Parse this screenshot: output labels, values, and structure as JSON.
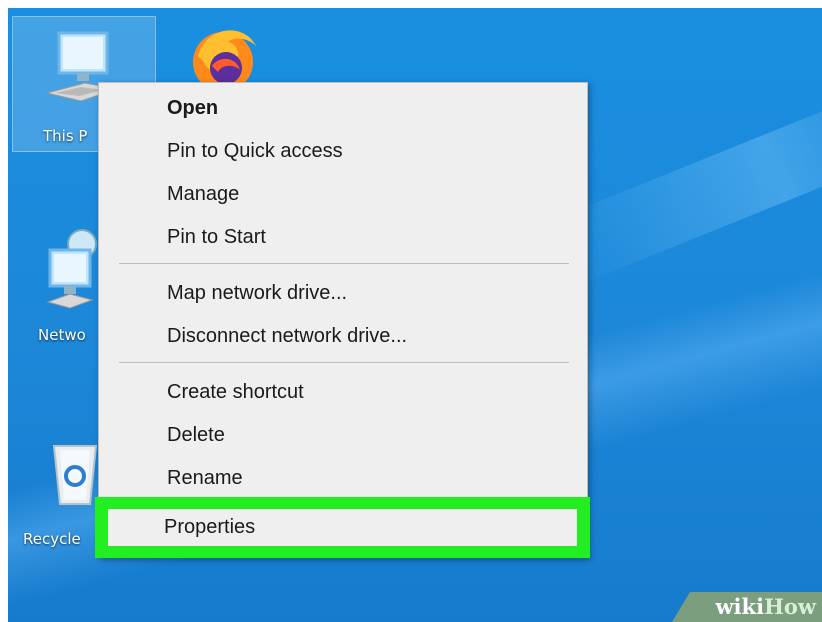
{
  "desktop": {
    "icons": [
      {
        "label": "This P",
        "icon": "computer-icon"
      },
      {
        "label": "Netwo",
        "icon": "network-icon"
      },
      {
        "label": "Recycle",
        "icon": "recycle-bin-icon"
      },
      {
        "label": "",
        "icon": "firefox-icon"
      }
    ]
  },
  "context_menu": {
    "groups": [
      [
        "Open",
        "Pin to Quick access",
        "Manage",
        "Pin to Start"
      ],
      [
        "Map network drive...",
        "Disconnect network drive..."
      ],
      [
        "Create shortcut",
        "Delete",
        "Rename"
      ]
    ],
    "highlighted_item": "Properties",
    "highlight_color": "#22ee22"
  },
  "watermark": {
    "part1": "wiki",
    "part2": "How"
  }
}
